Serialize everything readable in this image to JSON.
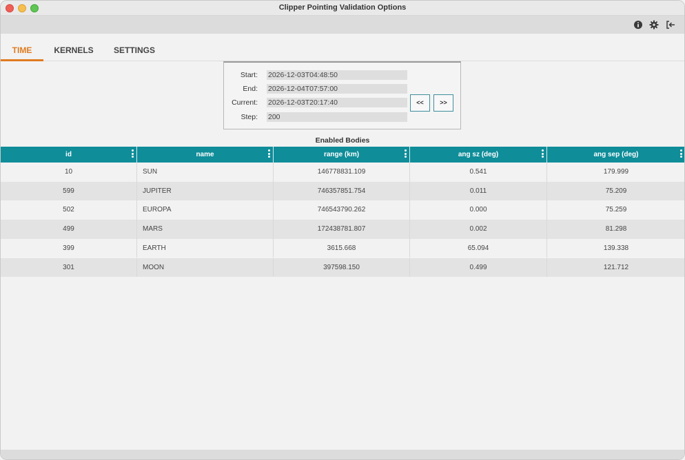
{
  "window": {
    "title": "Clipper Pointing Validation Options"
  },
  "toolbar": {
    "icons": [
      "info-icon",
      "gear-icon",
      "logout-icon"
    ]
  },
  "tabs": [
    {
      "label": "TIME",
      "active": true
    },
    {
      "label": "KERNELS",
      "active": false
    },
    {
      "label": "SETTINGS",
      "active": false
    }
  ],
  "time": {
    "start_label": "Start:",
    "start_value": "2026-12-03T04:48:50",
    "end_label": "End:",
    "end_value": "2026-12-04T07:57:00",
    "current_label": "Current:",
    "current_value": "2026-12-03T20:17:40",
    "step_label": "Step:",
    "step_value": "200",
    "back_label": "<<",
    "forward_label": ">>"
  },
  "bodies": {
    "title": "Enabled Bodies",
    "columns": [
      "id",
      "name",
      "range (km)",
      "ang sz (deg)",
      "ang sep (deg)"
    ],
    "rows": [
      [
        "10",
        "SUN",
        "146778831.109",
        "0.541",
        "179.999"
      ],
      [
        "599",
        "JUPITER",
        "746357851.754",
        "0.011",
        "75.209"
      ],
      [
        "502",
        "EUROPA",
        "746543790.262",
        "0.000",
        "75.259"
      ],
      [
        "499",
        "MARS",
        "172438781.807",
        "0.002",
        "81.298"
      ],
      [
        "399",
        "EARTH",
        "3615.668",
        "65.094",
        "139.338"
      ],
      [
        "301",
        "MOON",
        "397598.150",
        "0.499",
        "121.712"
      ]
    ]
  },
  "colors": {
    "accent": "#e07b20",
    "header": "#0f8d99"
  }
}
